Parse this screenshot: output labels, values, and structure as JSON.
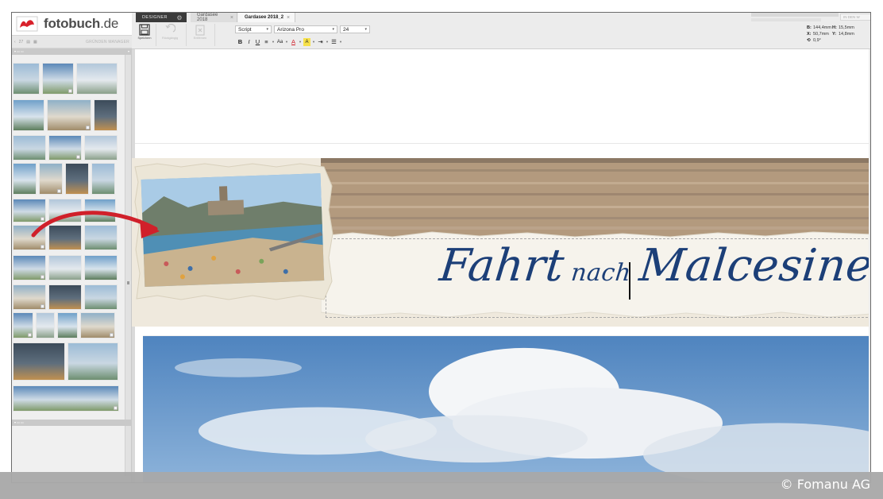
{
  "app": {
    "logo_text": "fotobuch",
    "logo_tld": ".de",
    "designer_label": "DESIGNER",
    "tabs": [
      {
        "label": "Gardasee 2018",
        "active": false
      },
      {
        "label": "Gardasee 2018_2",
        "active": true
      }
    ],
    "view_button": "IN DEN W"
  },
  "sidebar": {
    "page_counter": "27",
    "manager_label": "GRÜNDEN MANAGER"
  },
  "toolbar": {
    "save_label": "Speichern",
    "undo_label": "Rückgängig",
    "delete_label": "Entfernen",
    "text_type": "Script",
    "font": "Arizona Pro",
    "font_size": "24"
  },
  "format": {
    "bold": "B",
    "italic": "I",
    "underline": "U",
    "align": "≡",
    "case": "Aa",
    "color": "A",
    "highlight": "A",
    "indent": "⇥",
    "list": "☰"
  },
  "coords": {
    "b_label": "B:",
    "b_value": "144,4mm",
    "h_label": "H:",
    "h_value": "15,5mm",
    "x_label": "X:",
    "x_value": "50,7mm",
    "y_label": "Y:",
    "y_value": "14,8mm",
    "rot_label": "⟲",
    "rot_value": "0,9°"
  },
  "canvas": {
    "title_part1": "Fahrt",
    "title_part2": "nach",
    "title_part3": "Malcesine"
  },
  "colors": {
    "title": "#1c3f78",
    "arrow": "#d0202a",
    "designer_tab": "#3b3b3b"
  },
  "credit": "© Fomanu AG"
}
